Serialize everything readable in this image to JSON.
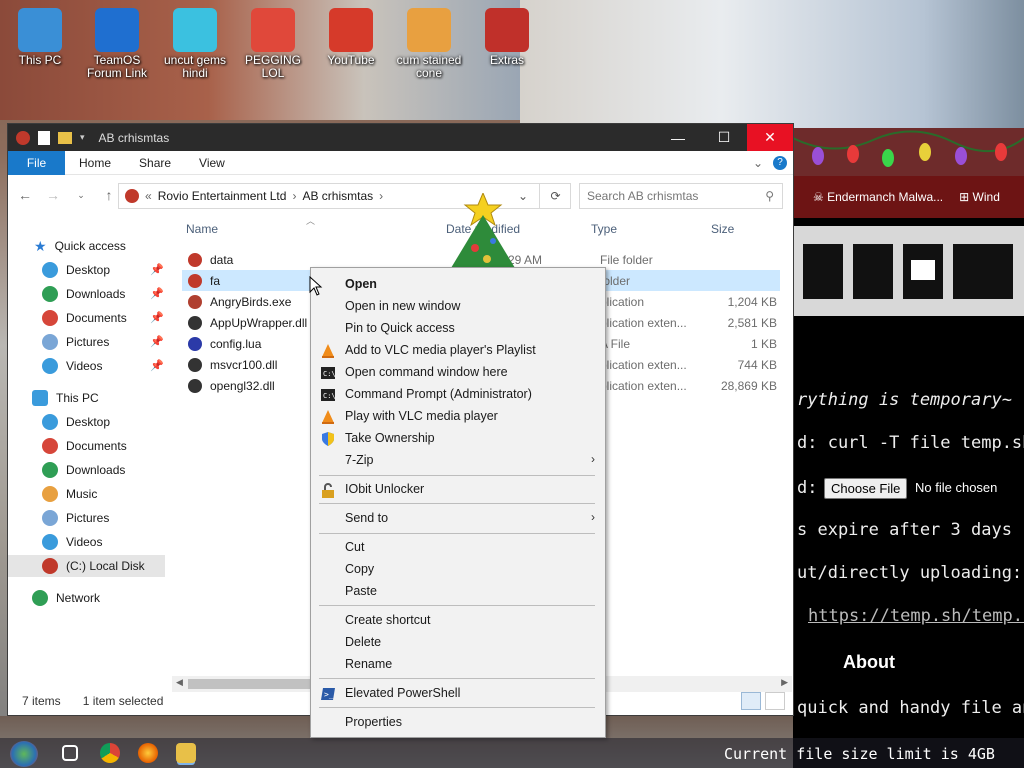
{
  "desktop": {
    "icons": [
      {
        "label": "This PC",
        "color": "#3a8fd6"
      },
      {
        "label": "TeamOS Forum Link",
        "color": "#1f6fd0"
      },
      {
        "label": "uncut gems hindi",
        "color": "#3bc1e0"
      },
      {
        "label": "PEGGING LOL",
        "color": "#e0483a"
      },
      {
        "label": "YouTube",
        "color": "#d63a2a"
      },
      {
        "label": "cum stained cone",
        "color": "#e8a040"
      },
      {
        "label": "Extras",
        "color": "#c0302a"
      }
    ]
  },
  "browser": {
    "tabs": [
      "Endermanch Malwa...",
      "Wind"
    ],
    "lines": {
      "tagline": "rything is temporary~",
      "cmd": "d: curl -T file temp.sh",
      "upload_prefix": "d:",
      "choose_file": "Choose File",
      "no_file": "No file chosen",
      "expire": "s expire after 3 days",
      "directly": "ut/directly uploading: h",
      "link": "https://temp.sh/temp.s",
      "about": "About",
      "quick": "quick and handy file and"
    },
    "footer": "Current file size limit is 4GB"
  },
  "explorer": {
    "title": "AB crhismtas",
    "ribbon": {
      "file": "File",
      "tabs": [
        "Home",
        "Share",
        "View"
      ]
    },
    "address": {
      "parts": [
        "Rovio Entertainment Ltd",
        "AB crhismtas"
      ]
    },
    "search_placeholder": "Search AB crhismtas",
    "columns": {
      "name": "Name",
      "date": "Date modified",
      "type": "Type",
      "size": "Size"
    },
    "nav": {
      "quick_access": "Quick access",
      "quick_items": [
        "Desktop",
        "Downloads",
        "Documents",
        "Pictures",
        "Videos"
      ],
      "this_pc": "This PC",
      "pc_items": [
        "Desktop",
        "Documents",
        "Downloads",
        "Music",
        "Pictures",
        "Videos",
        "(C:) Local Disk"
      ],
      "network": "Network"
    },
    "files": [
      {
        "name": "data",
        "date": "29 AM",
        "type": "File folder",
        "size": ""
      },
      {
        "name": "fa",
        "date": "",
        "type": "folder",
        "size": ""
      },
      {
        "name": "AngryBirds.exe",
        "date": "",
        "type": "plication",
        "size": "1,204 KB"
      },
      {
        "name": "AppUpWrapper.dll",
        "date": "",
        "type": "plication exten...",
        "size": "2,581 KB"
      },
      {
        "name": "config.lua",
        "date": "",
        "type": "A File",
        "size": "1 KB"
      },
      {
        "name": "msvcr100.dll",
        "date": "",
        "type": "plication exten...",
        "size": "744 KB"
      },
      {
        "name": "opengl32.dll",
        "date": "",
        "type": "plication exten...",
        "size": "28,869 KB"
      }
    ],
    "status": {
      "items": "7 items",
      "selected": "1 item selected"
    }
  },
  "context_menu": {
    "open": "Open",
    "open_new_window": "Open in new window",
    "pin_quick": "Pin to Quick access",
    "vlc_playlist": "Add to VLC media player's Playlist",
    "cmd_here": "Open command window here",
    "cmd_admin": "Command Prompt (Administrator)",
    "vlc_play": "Play with VLC media player",
    "take_ownership": "Take Ownership",
    "sevenzip": "7-Zip",
    "iobit": "IObit Unlocker",
    "send_to": "Send to",
    "cut": "Cut",
    "copy": "Copy",
    "paste": "Paste",
    "create_shortcut": "Create shortcut",
    "delete": "Delete",
    "rename": "Rename",
    "powershell": "Elevated PowerShell",
    "properties": "Properties"
  }
}
